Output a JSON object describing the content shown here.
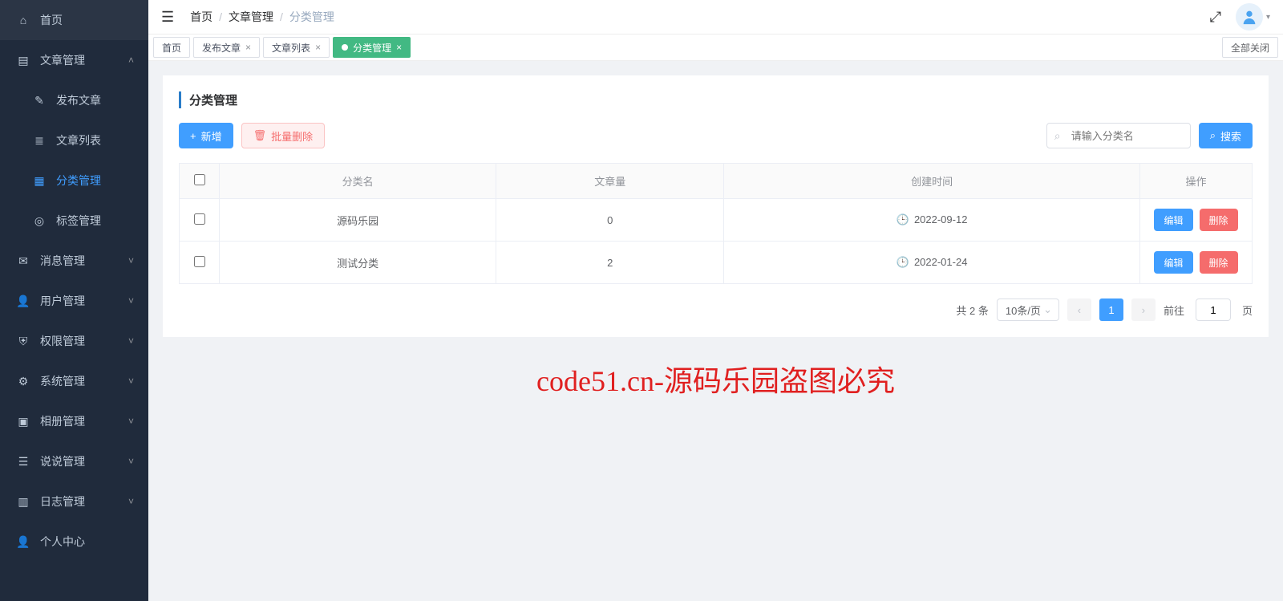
{
  "sidebar": {
    "items": [
      {
        "label": "首页",
        "active": false,
        "expandable": false,
        "expanded": false,
        "sub": false
      },
      {
        "label": "文章管理",
        "active": false,
        "expandable": true,
        "expanded": true,
        "sub": false
      },
      {
        "label": "发布文章",
        "active": false,
        "expandable": false,
        "expanded": false,
        "sub": true
      },
      {
        "label": "文章列表",
        "active": false,
        "expandable": false,
        "expanded": false,
        "sub": true
      },
      {
        "label": "分类管理",
        "active": true,
        "expandable": false,
        "expanded": false,
        "sub": true
      },
      {
        "label": "标签管理",
        "active": false,
        "expandable": false,
        "expanded": false,
        "sub": true
      },
      {
        "label": "消息管理",
        "active": false,
        "expandable": true,
        "expanded": false,
        "sub": false
      },
      {
        "label": "用户管理",
        "active": false,
        "expandable": true,
        "expanded": false,
        "sub": false
      },
      {
        "label": "权限管理",
        "active": false,
        "expandable": true,
        "expanded": false,
        "sub": false
      },
      {
        "label": "系统管理",
        "active": false,
        "expandable": true,
        "expanded": false,
        "sub": false
      },
      {
        "label": "相册管理",
        "active": false,
        "expandable": true,
        "expanded": false,
        "sub": false
      },
      {
        "label": "说说管理",
        "active": false,
        "expandable": true,
        "expanded": false,
        "sub": false
      },
      {
        "label": "日志管理",
        "active": false,
        "expandable": true,
        "expanded": false,
        "sub": false
      },
      {
        "label": "个人中心",
        "active": false,
        "expandable": false,
        "expanded": false,
        "sub": false
      }
    ]
  },
  "breadcrumb": {
    "p0": "首页",
    "p1": "文章管理",
    "p2": "分类管理"
  },
  "tabs": {
    "items": [
      {
        "label": "首页",
        "closable": false,
        "active": false
      },
      {
        "label": "发布文章",
        "closable": true,
        "active": false
      },
      {
        "label": "文章列表",
        "closable": true,
        "active": false
      },
      {
        "label": "分类管理",
        "closable": true,
        "active": true
      }
    ],
    "close_all": "全部关闭"
  },
  "page": {
    "title": "分类管理",
    "add_label": "新增",
    "batch_delete_label": "批量删除",
    "search_placeholder": "请输入分类名",
    "search_btn": "搜索",
    "columns": {
      "name": "分类名",
      "count": "文章量",
      "created": "创建时间",
      "ops": "操作"
    },
    "edit_label": "编辑",
    "delete_label": "删除",
    "rows": [
      {
        "name": "源码乐园",
        "count": "0",
        "created": "2022-09-12"
      },
      {
        "name": "测试分类",
        "count": "2",
        "created": "2022-01-24"
      }
    ],
    "pager": {
      "total_text": "共 2 条",
      "size_text": "10条/页",
      "current": "1",
      "goto_label": "前往",
      "goto_value": "1",
      "page_suffix": "页"
    }
  },
  "watermark": "code51.cn-源码乐园盗图必究"
}
